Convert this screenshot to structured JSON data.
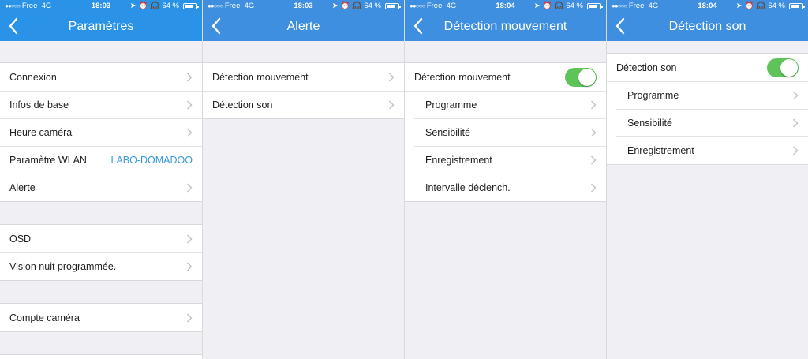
{
  "colors": {
    "navbar": "#3e8fe0",
    "navbar_first": "#2a93e8",
    "toggle_on": "#5ec45a",
    "link_value": "#3b9ad9"
  },
  "screens": [
    {
      "status": {
        "carrier": "Free",
        "network": "4G",
        "time": "18:03",
        "battery": "64 %"
      },
      "title": "Paramètres",
      "groups": [
        [
          {
            "label": "Connexion"
          },
          {
            "label": "Infos de base"
          },
          {
            "label": "Heure caméra"
          },
          {
            "label": "Paramètre WLAN",
            "value": "LABO-DOMADOO"
          },
          {
            "label": "Alerte"
          }
        ],
        [
          {
            "label": "OSD"
          },
          {
            "label": "Vision nuit programmée."
          }
        ],
        [
          {
            "label": "Compte caméra"
          }
        ]
      ]
    },
    {
      "status": {
        "carrier": "Free",
        "network": "4G",
        "time": "18:03",
        "battery": "64 %"
      },
      "title": "Alerte",
      "items": [
        {
          "label": "Détection mouvement"
        },
        {
          "label": "Détection son"
        }
      ]
    },
    {
      "status": {
        "carrier": "Free",
        "network": "4G",
        "time": "18:04",
        "battery": "64 %"
      },
      "title": "Détection mouvement",
      "toggle_label": "Détection mouvement",
      "toggle_on": true,
      "items": [
        {
          "label": "Programme"
        },
        {
          "label": "Sensibilité"
        },
        {
          "label": "Enregistrement"
        },
        {
          "label": "Intervalle déclench."
        }
      ]
    },
    {
      "status": {
        "carrier": "Free",
        "network": "4G",
        "time": "18:04",
        "battery": "64 %"
      },
      "title": "Détection son",
      "toggle_label": "Détection son",
      "toggle_on": true,
      "items": [
        {
          "label": "Programme"
        },
        {
          "label": "Sensibilité"
        },
        {
          "label": "Enregistrement"
        }
      ]
    }
  ]
}
